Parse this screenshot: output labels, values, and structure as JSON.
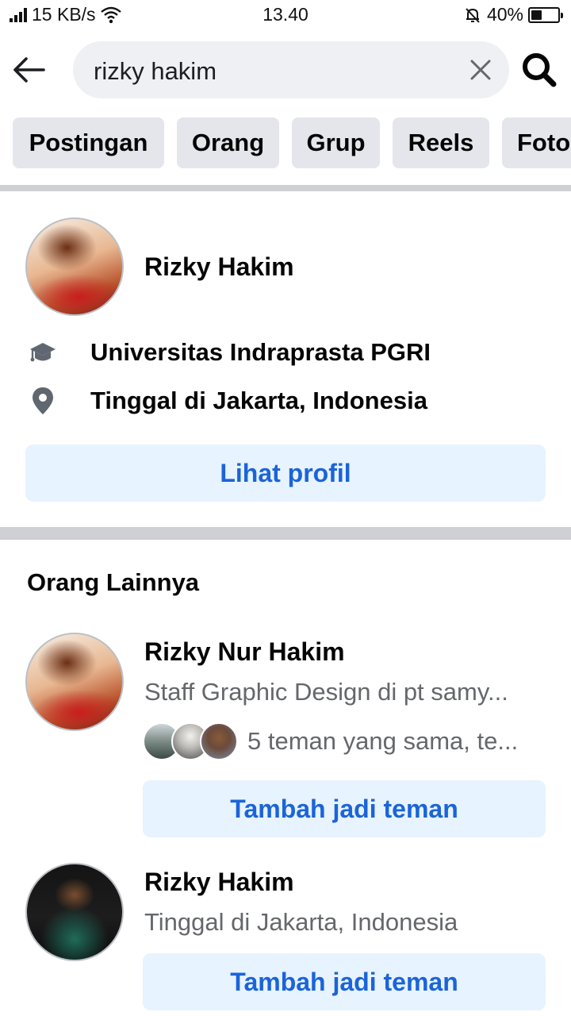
{
  "status_bar": {
    "speed": "15 KB/s",
    "time": "13.40",
    "battery": "40%",
    "battery_level": 0.4
  },
  "search": {
    "query": "rizky hakim"
  },
  "tabs": [
    {
      "label": "Postingan"
    },
    {
      "label": "Orang"
    },
    {
      "label": "Grup"
    },
    {
      "label": "Reels"
    },
    {
      "label": "Foto"
    }
  ],
  "top_result": {
    "name": "Rizky Hakim",
    "education": "Universitas Indraprasta PGRI",
    "location": "Tinggal di Jakarta, Indonesia",
    "view_profile_label": "Lihat profil"
  },
  "others": {
    "title": "Orang Lainnya",
    "people": [
      {
        "name": "Rizky Nur Hakim",
        "subtitle": "Staff Graphic Design di pt samy...",
        "mutual": "5 teman yang sama, te...",
        "button": "Tambah jadi teman"
      },
      {
        "name": "Rizky Hakim",
        "subtitle": "Tinggal di Jakarta, Indonesia",
        "button": "Tambah jadi teman"
      }
    ]
  },
  "icons": {
    "back": "arrow-left-icon",
    "clear": "close-icon",
    "search": "search-icon",
    "education": "graduation-cap-icon",
    "location": "location-pin-icon"
  },
  "colors": {
    "accent": "#1b64d8",
    "button_bg": "#e7f3ff",
    "chip_bg": "#e4e6eb",
    "search_bg": "#eef0f3",
    "secondary_text": "#65676b"
  }
}
